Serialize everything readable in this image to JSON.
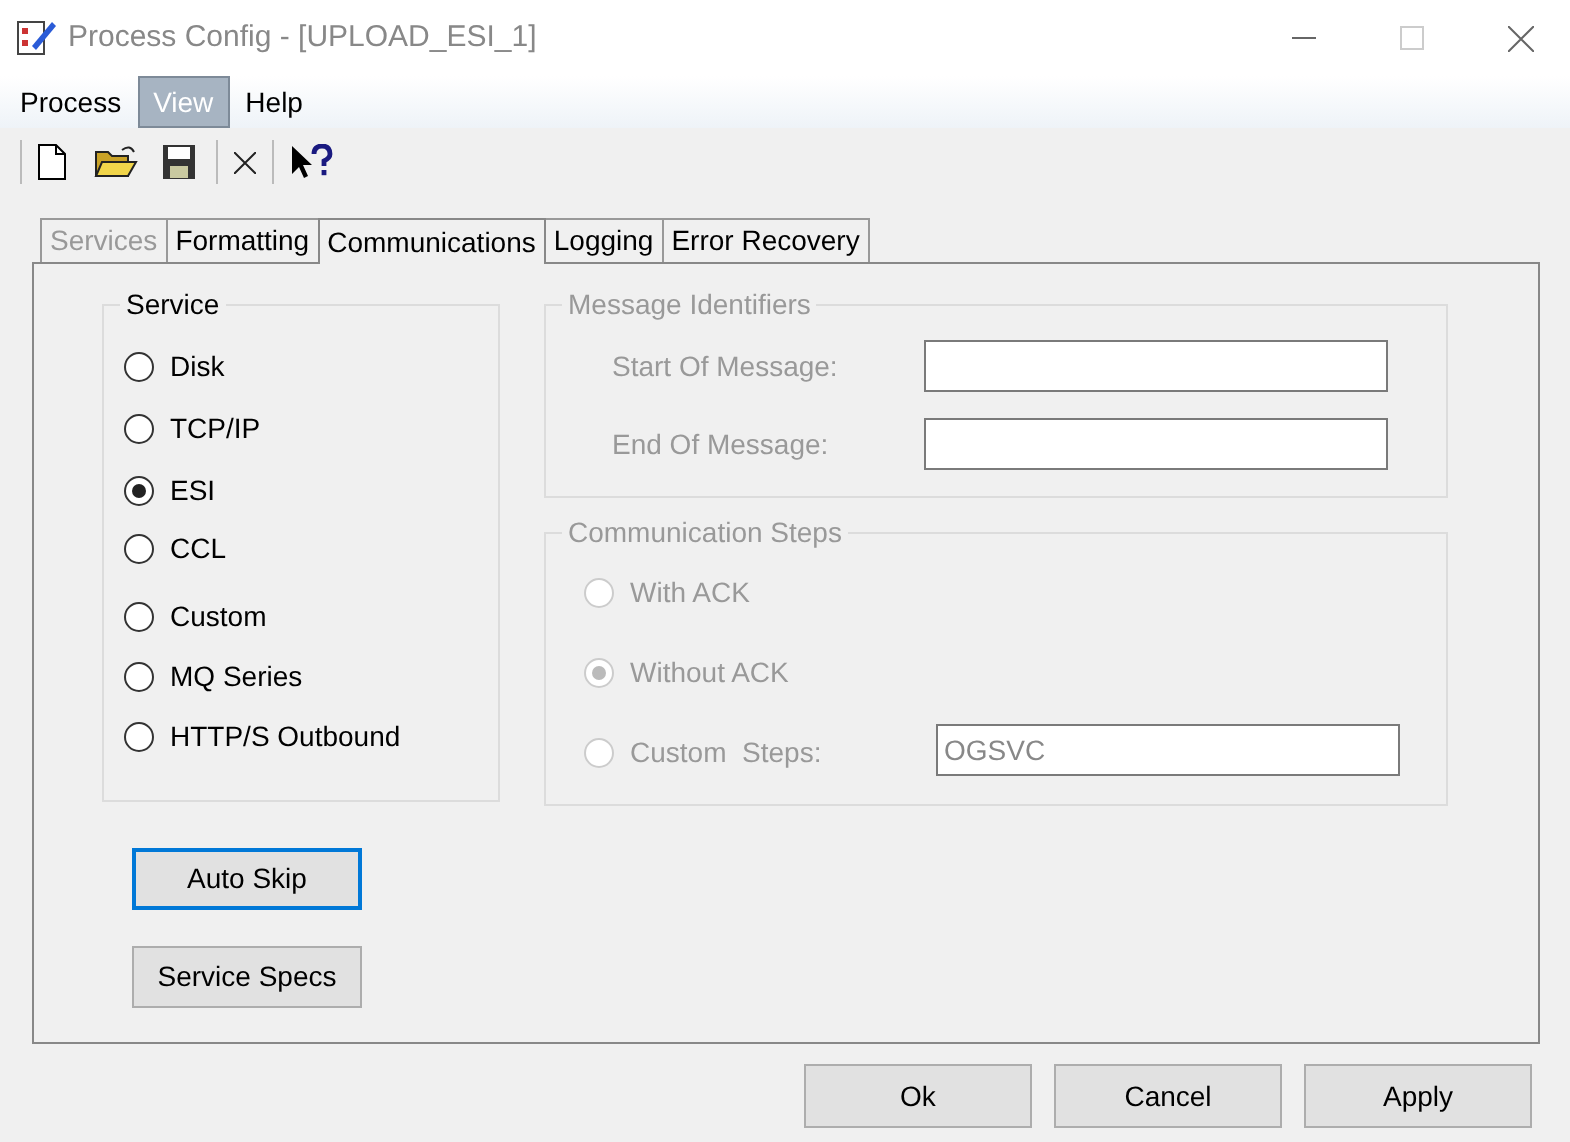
{
  "window": {
    "title": "Process Config - [UPLOAD_ESI_1]"
  },
  "menu": [
    {
      "label": "Process",
      "selected": false
    },
    {
      "label": "View",
      "selected": true
    },
    {
      "label": "Help",
      "selected": false
    }
  ],
  "tabs": [
    {
      "label": "Services",
      "selected": false,
      "disabled": true
    },
    {
      "label": "Formatting",
      "selected": false,
      "disabled": false
    },
    {
      "label": "Communications",
      "selected": true,
      "disabled": false
    },
    {
      "label": "Logging",
      "selected": false,
      "disabled": false
    },
    {
      "label": "Error Recovery",
      "selected": false,
      "disabled": false
    }
  ],
  "service": {
    "title": "Service",
    "options": [
      {
        "label": "Disk",
        "selected": false
      },
      {
        "label": "TCP/IP",
        "selected": false
      },
      {
        "label": "ESI",
        "selected": true
      },
      {
        "label": "CCL",
        "selected": false
      },
      {
        "label": "Custom",
        "selected": false
      },
      {
        "label": "MQ Series",
        "selected": false
      },
      {
        "label": "HTTP/S Outbound",
        "selected": false
      }
    ]
  },
  "message_identifiers": {
    "title": "Message Identifiers",
    "disabled": true,
    "fields": [
      {
        "label": "Start Of Message:"
      },
      {
        "label": "End Of Message:"
      }
    ]
  },
  "communication_steps": {
    "title": "Communication Steps",
    "disabled": true,
    "options": [
      {
        "label": "With ACK",
        "selected": false
      },
      {
        "label": "Without ACK",
        "selected": true
      },
      {
        "label": "Custom  Steps:",
        "selected": false,
        "value": "OGSVC"
      }
    ]
  },
  "side_buttons": [
    {
      "label": "Auto Skip",
      "focused": true
    },
    {
      "label": "Service Specs",
      "focused": false
    }
  ],
  "dialog_buttons": [
    "Ok",
    "Cancel",
    "Apply"
  ]
}
